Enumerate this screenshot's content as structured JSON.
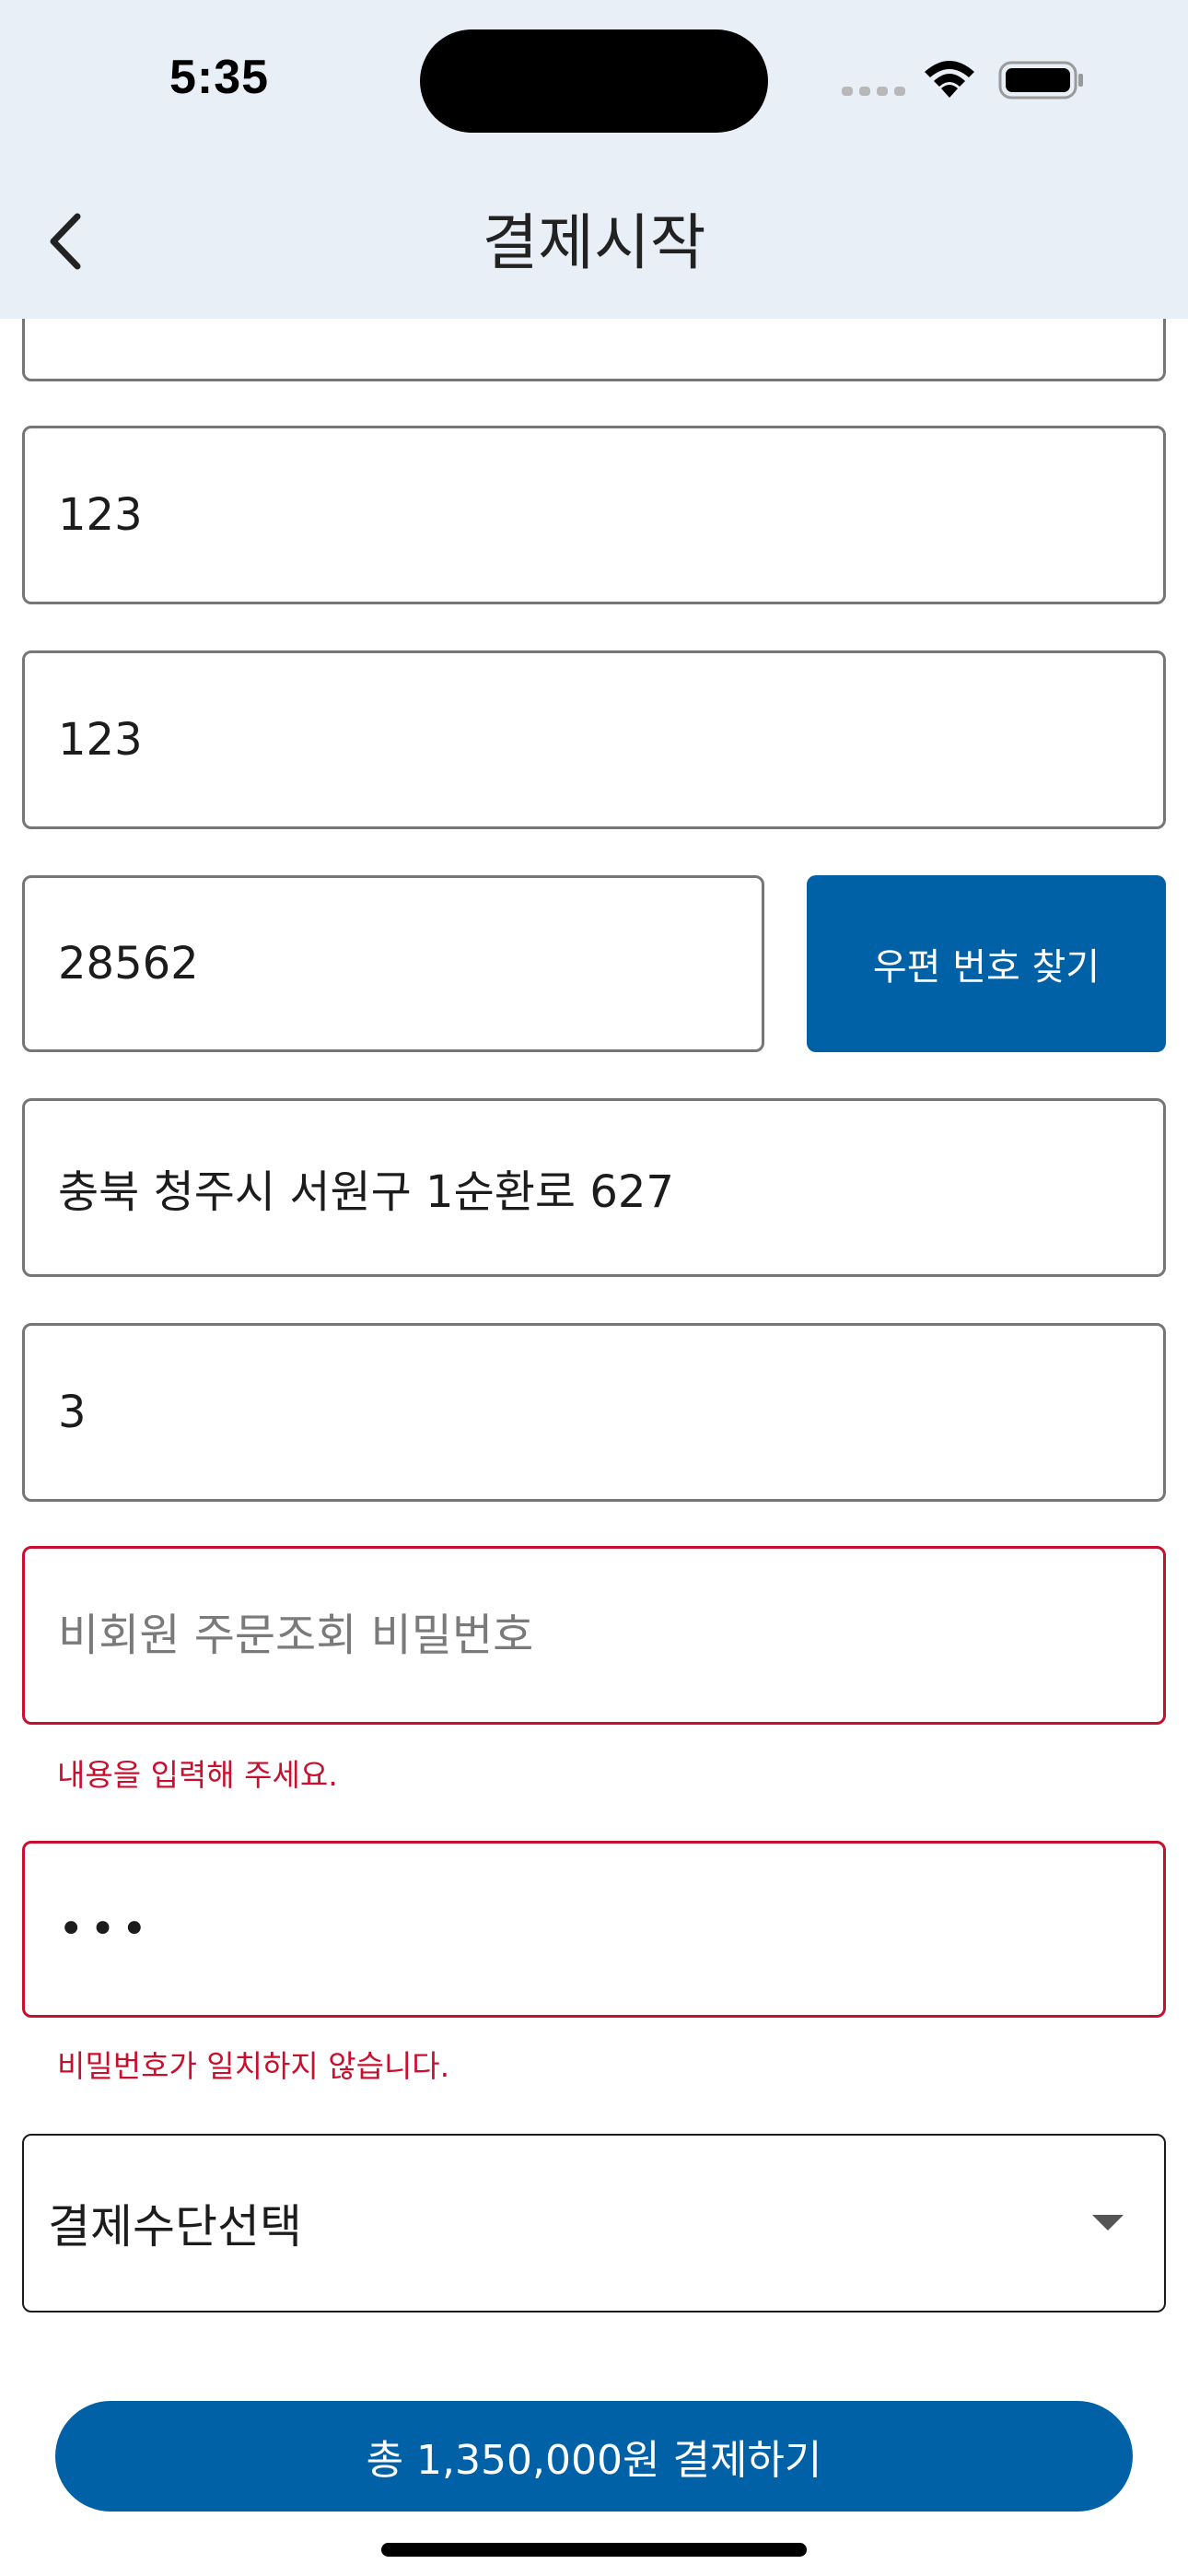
{
  "status_bar": {
    "time": "5:35"
  },
  "header": {
    "title": "결제시작",
    "back_icon": "chevron-left-icon"
  },
  "form": {
    "field_top_partial_value": "",
    "field_1_value": "123",
    "field_2_value": "123",
    "zip_value": "28562",
    "zip_button_label": "우편 번호 찾기",
    "address_value": "충북 청주시 서원구 1순환로 627",
    "address_detail_value": "3",
    "password_placeholder": "비회원 주문조회 비밀번호",
    "password_error": "내용을 입력해 주세요.",
    "password_confirm_value": "•••",
    "password_confirm_error": "비밀번호가 일치하지 않습니다.",
    "payment_method_selected": "결제수단선택"
  },
  "pay_button_label": "총 1,350,000원 결제하기",
  "colors": {
    "header_bg": "#e9eff6",
    "primary": "#0061a6",
    "error": "#c8102e",
    "border": "#767676"
  }
}
